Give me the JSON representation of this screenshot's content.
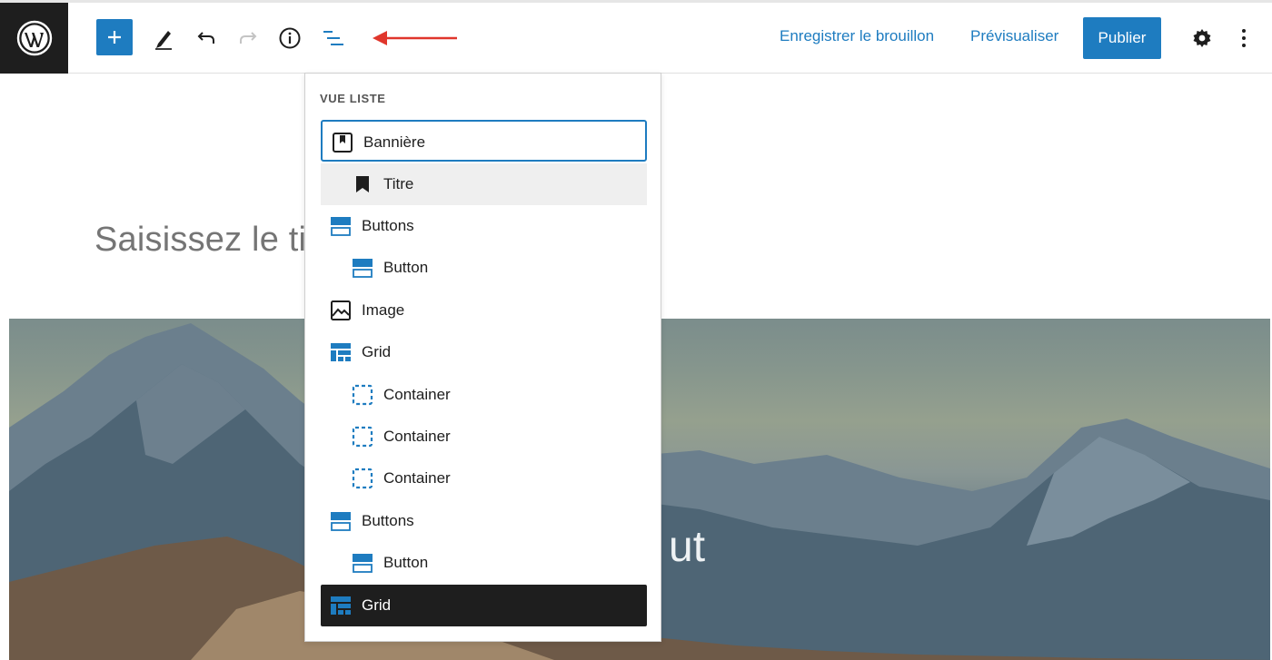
{
  "toolbar": {
    "logo_icon": "wordpress-logo",
    "add_icon": "plus-icon",
    "tools_icon": "pencil-icon",
    "undo_icon": "undo-icon",
    "redo_icon": "redo-icon",
    "info_icon": "info-icon",
    "list_view_icon": "list-view-icon",
    "save_draft_label": "Enregistrer le brouillon",
    "preview_label": "Prévisualiser",
    "publish_label": "Publier",
    "settings_icon": "gear-icon",
    "more_icon": "kebab-icon",
    "accent": "#1e7cc0",
    "annotation_color": "#e0362c"
  },
  "editor": {
    "title_placeholder": "Saisissez le tit",
    "banner_text": "ut"
  },
  "list_view": {
    "title": "VUE LISTE",
    "items": [
      {
        "label": "Bannière",
        "icon": "banner-block-icon",
        "level": 0,
        "state": "selected"
      },
      {
        "label": "Titre",
        "icon": "bookmark-icon",
        "level": 1,
        "state": "hover"
      },
      {
        "label": "Buttons",
        "icon": "buttons-block-icon",
        "level": 0,
        "state": ""
      },
      {
        "label": "Button",
        "icon": "button-block-icon",
        "level": 1,
        "state": ""
      },
      {
        "label": "Image",
        "icon": "image-block-icon",
        "level": 0,
        "state": ""
      },
      {
        "label": "Grid",
        "icon": "grid-block-icon",
        "level": 0,
        "state": ""
      },
      {
        "label": "Container",
        "icon": "container-block-icon",
        "level": 1,
        "state": ""
      },
      {
        "label": "Container",
        "icon": "container-block-icon",
        "level": 1,
        "state": ""
      },
      {
        "label": "Container",
        "icon": "container-block-icon",
        "level": 1,
        "state": ""
      },
      {
        "label": "Buttons",
        "icon": "buttons-block-icon",
        "level": 0,
        "state": ""
      },
      {
        "label": "Button",
        "icon": "button-block-icon",
        "level": 1,
        "state": ""
      },
      {
        "label": "Grid",
        "icon": "grid-block-icon",
        "level": 0,
        "state": "active"
      }
    ]
  }
}
